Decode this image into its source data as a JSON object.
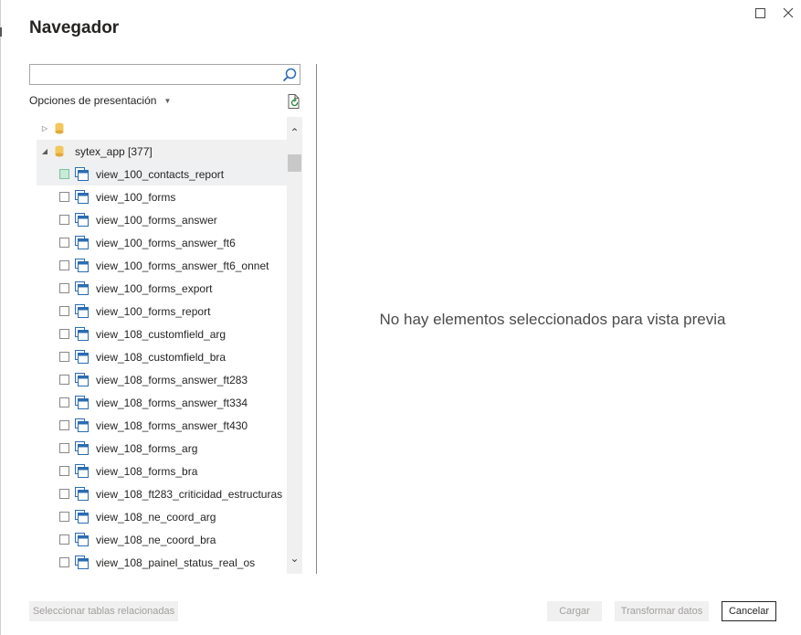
{
  "window": {
    "title": "Navegador",
    "maximize_icon": "maximize-icon",
    "close_icon": "close-icon"
  },
  "search": {
    "value": "",
    "placeholder": "",
    "icon": "search-icon"
  },
  "options": {
    "label": "Opciones de presentación",
    "refresh_icon": "refresh-icon"
  },
  "tree": {
    "nodes": [
      {
        "label": "",
        "expanded": false,
        "icon": "database-icon"
      },
      {
        "label": "sytex_app [377]",
        "expanded": true,
        "icon": "database-icon"
      }
    ],
    "items": [
      {
        "label": "view_100_contacts_report"
      },
      {
        "label": "view_100_forms"
      },
      {
        "label": "view_100_forms_answer"
      },
      {
        "label": "view_100_forms_answer_ft6"
      },
      {
        "label": "view_100_forms_answer_ft6_onnet"
      },
      {
        "label": "view_100_forms_export"
      },
      {
        "label": "view_100_forms_report"
      },
      {
        "label": "view_108_customfield_arg"
      },
      {
        "label": "view_108_customfield_bra"
      },
      {
        "label": "view_108_forms_answer_ft283"
      },
      {
        "label": "view_108_forms_answer_ft334"
      },
      {
        "label": "view_108_forms_answer_ft430"
      },
      {
        "label": "view_108_forms_arg"
      },
      {
        "label": "view_108_forms_bra"
      },
      {
        "label": "view_108_ft283_criticidad_estructuras"
      },
      {
        "label": "view_108_ne_coord_arg"
      },
      {
        "label": "view_108_ne_coord_bra"
      },
      {
        "label": "view_108_painel_status_real_os"
      }
    ]
  },
  "preview": {
    "empty_message": "No hay elementos seleccionados para vista previa"
  },
  "footer": {
    "related_tables": "Seleccionar tablas relacionadas",
    "load": "Cargar",
    "transform": "Transformar datos",
    "cancel": "Cancelar"
  },
  "colors": {
    "db_icon": "#f2c75c",
    "view_icon": "#2b6cb3",
    "checkbox_selected": "#c8ead7"
  }
}
